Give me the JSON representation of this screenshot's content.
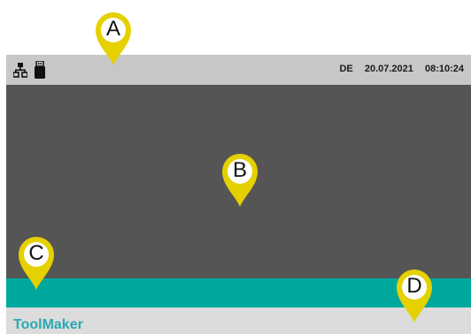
{
  "status_bar": {
    "network_icon": "network-icon",
    "usb_icon": "usb-stick-icon",
    "language": "DE",
    "date": "20.07.2021",
    "time": "08:10:24"
  },
  "footer": {
    "brand": "ToolMaker"
  },
  "markers": [
    {
      "label": "A"
    },
    {
      "label": "B"
    },
    {
      "label": "C"
    },
    {
      "label": "D"
    }
  ],
  "colors": {
    "status_bar": "#c7c7c7",
    "main_area": "#555555",
    "teal_bar": "#00a79d",
    "footer": "#dcdcdc",
    "brand_text": "#2aa8b2",
    "marker_yellow": "#e5d000"
  }
}
